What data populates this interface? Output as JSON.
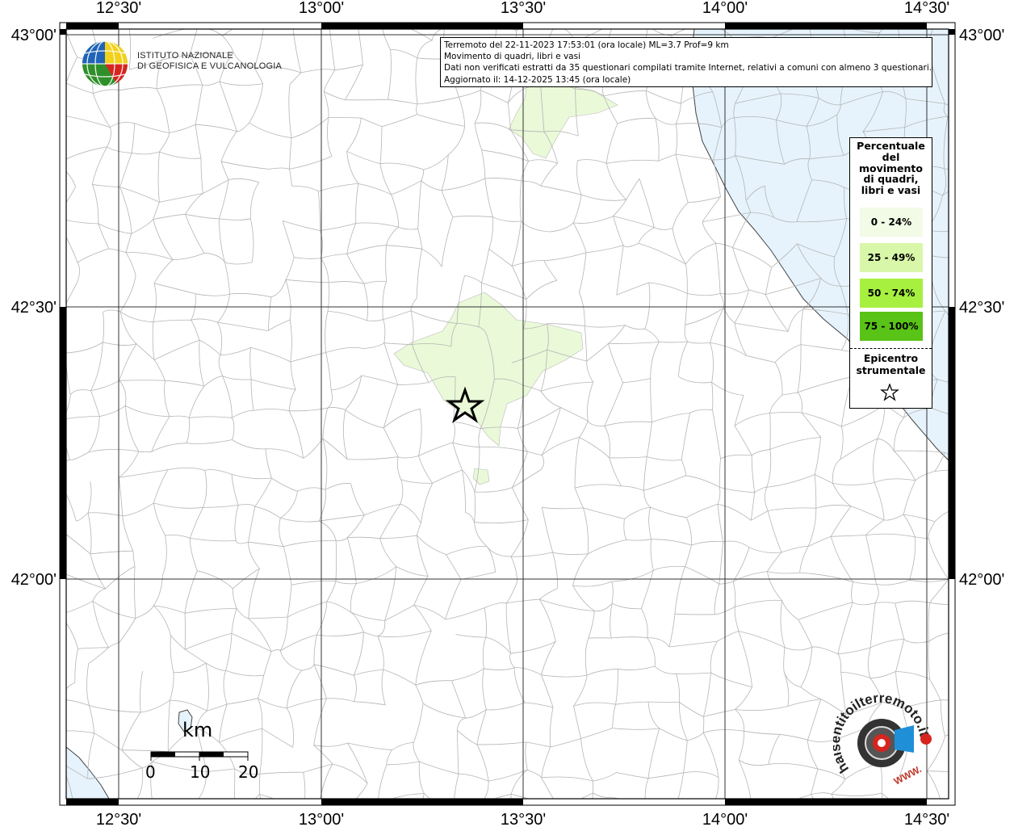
{
  "info": {
    "line1": "Terremoto del 22-11-2023 17:53:01 (ora locale) ML=3.7 Prof=9 km",
    "line2": "Movimento di quadri, libri e vasi",
    "line3": "Dati non verificati estratti da 35 questionari compilati tramite Internet, relativi a comuni con almeno 3 questionari.",
    "line4": "Aggiornato il: 14-12-2025 13:45 (ora locale)"
  },
  "axes": {
    "top": [
      "12°30'",
      "13°00'",
      "13°30'",
      "14°00'",
      "14°30'"
    ],
    "bottom": [
      "12°30'",
      "13°00'",
      "13°30'",
      "14°00'",
      "14°30'"
    ],
    "left": [
      "43°00'",
      "42°30'",
      "42°00'"
    ],
    "right": [
      "43°00'",
      "42°30'",
      "42°00'"
    ]
  },
  "legend": {
    "title": [
      "Percentuale",
      "del",
      "movimento",
      "di quadri,",
      "libri e vasi"
    ],
    "classes": [
      {
        "label": "0 - 24%",
        "color": "#f1fbe6"
      },
      {
        "label": "25 - 49%",
        "color": "#d9f7a8"
      },
      {
        "label": "50 - 74%",
        "color": "#a7f03f"
      },
      {
        "label": "75 - 100%",
        "color": "#59c317"
      }
    ],
    "epicenter_title": [
      "Epicentro",
      "strumentale"
    ],
    "epicenter_icon": "star-outline-icon"
  },
  "scalebar": {
    "unit": "km",
    "ticks": [
      "0",
      "10",
      "20"
    ]
  },
  "logo": {
    "line1": "ISTITUTO NAZIONALE",
    "line2": "DI GEOFISICA E VULCANOLOGIA",
    "icon": "ingv-globe-icon"
  },
  "sentito_logo": {
    "text": "haisentitoilterremoto.it",
    "url_text": "WWW.",
    "icon": "seismometer-target-icon"
  },
  "colors": {
    "sea": "#e6f3fc",
    "felt_light": "#f1fbe6",
    "felt_low": "#e9f9d6",
    "land": "#ffffff",
    "boundary": "#b5b5b5"
  }
}
